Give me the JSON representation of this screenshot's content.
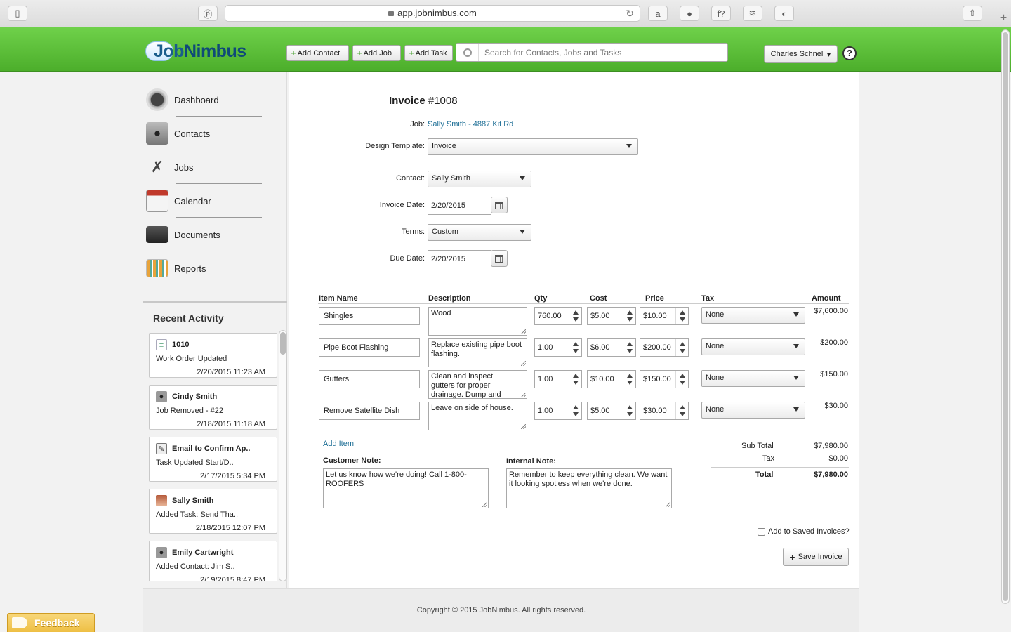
{
  "browser": {
    "url": "app.jobnimbus.com"
  },
  "header": {
    "logo": {
      "part1": "Job",
      "part2": "Nimbus"
    },
    "add_contact": "Add Contact",
    "add_job": "Add Job",
    "add_task": "Add Task",
    "search_placeholder": "Search for Contacts, Jobs and Tasks",
    "user_name": "Charles Schnell",
    "help": "?"
  },
  "sidebar": {
    "nav": [
      {
        "label": "Dashboard",
        "icon": "dashboard-gauge-icon"
      },
      {
        "label": "Contacts",
        "icon": "contacts-person-icon"
      },
      {
        "label": "Jobs",
        "icon": "jobs-tools-icon"
      },
      {
        "label": "Calendar",
        "icon": "calendar-icon"
      },
      {
        "label": "Documents",
        "icon": "documents-folder-icon"
      },
      {
        "label": "Reports",
        "icon": "reports-chart-icon"
      }
    ],
    "recent_activity": {
      "title": "Recent Activity",
      "items": [
        {
          "title": "1010",
          "sub": "Work Order Updated",
          "date": "2/20/2015 11:23 AM",
          "icon": "document-icon"
        },
        {
          "title": "Cindy Smith",
          "sub": "Job Removed - #22",
          "date": "2/18/2015 11:18 AM",
          "icon": "person-icon"
        },
        {
          "title": "Email to Confirm Ap..",
          "sub": "Task Updated Start/D..",
          "date": "2/17/2015 5:34 PM",
          "icon": "task-edit-icon"
        },
        {
          "title": "Sally Smith",
          "sub": "Added Task: Send Tha..",
          "date": "2/18/2015 12:07 PM",
          "icon": "avatar-photo-icon"
        },
        {
          "title": "Emily Cartwright",
          "sub": "Added Contact: Jim S..",
          "date": "2/19/2015 8:47 PM",
          "icon": "person-icon"
        }
      ]
    }
  },
  "invoice": {
    "title": "Invoice",
    "number": "#1008",
    "job_label": "Job:",
    "job_value": "Sally Smith - 4887 Kit Rd",
    "design_template_label": "Design Template:",
    "design_template_value": "Invoice",
    "contact_label": "Contact:",
    "contact_value": "Sally Smith",
    "invoice_date_label": "Invoice Date:",
    "invoice_date_value": "2/20/2015",
    "terms_label": "Terms:",
    "terms_value": "Custom",
    "due_date_label": "Due Date:",
    "due_date_value": "2/20/2015",
    "columns": [
      "Item Name",
      "Description",
      "Qty",
      "Cost",
      "Price",
      "Tax",
      "Amount"
    ],
    "items": [
      {
        "name": "Shingles",
        "description": "Wood",
        "qty": "760.00",
        "cost": "$5.00",
        "price": "$10.00",
        "tax": "None",
        "amount": "$7,600.00"
      },
      {
        "name": "Pipe Boot Flashing",
        "description": "Replace existing pipe boot flashing.",
        "qty": "1.00",
        "cost": "$6.00",
        "price": "$200.00",
        "tax": "None",
        "amount": "$200.00"
      },
      {
        "name": "Gutters",
        "description": "Clean and inspect gutters for proper drainage. Dump and",
        "qty": "1.00",
        "cost": "$10.00",
        "price": "$150.00",
        "tax": "None",
        "amount": "$150.00"
      },
      {
        "name": "Remove Satellite Dish",
        "description": "Leave on side of house.",
        "qty": "1.00",
        "cost": "$5.00",
        "price": "$30.00",
        "tax": "None",
        "amount": "$30.00"
      }
    ],
    "add_item": "Add Item",
    "customer_note_label": "Customer Note:",
    "customer_note": "Let us know how we're doing! Call 1-800-ROOFERS",
    "internal_note_label": "Internal Note:",
    "internal_note": "Remember to keep everything clean. We want it looking spotless when we're done.",
    "subtotal_label": "Sub Total",
    "subtotal": "$7,980.00",
    "tax_label": "Tax",
    "tax": "$0.00",
    "total_label": "Total",
    "total": "$7,980.00",
    "save_to_saved": "Add to Saved Invoices?",
    "save_button": "Save Invoice"
  },
  "footer": {
    "copyright": "Copyright © 2015 JobNimbus. All rights reserved.",
    "feedback": "Feedback"
  },
  "colors": {
    "header_green": "#5cc13a",
    "link_blue": "#1e6f96",
    "feedback_yellow": "#f0c24c"
  }
}
